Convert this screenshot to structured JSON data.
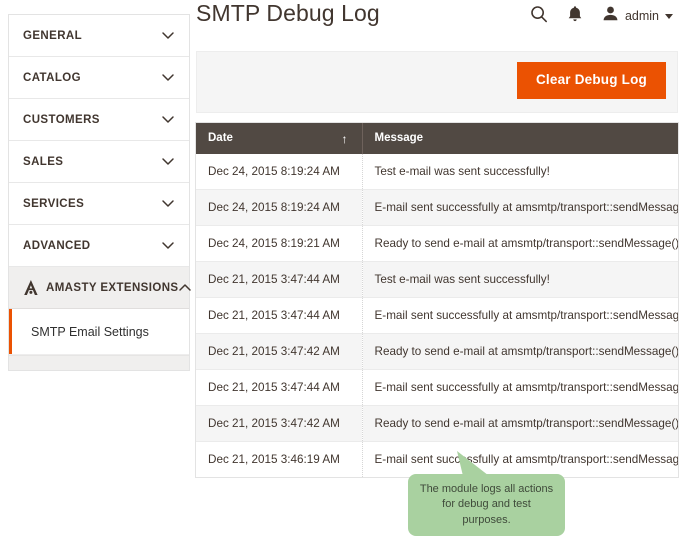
{
  "header": {
    "title": "SMTP Debug Log",
    "search_icon": "search-icon",
    "bell_icon": "notifications-bell-icon",
    "user_icon": "user-avatar-icon",
    "user_name": "admin"
  },
  "sidebar": {
    "items": [
      {
        "label": "GENERAL",
        "icon": "chevron-down-icon",
        "expanded": false
      },
      {
        "label": "CATALOG",
        "icon": "chevron-down-icon",
        "expanded": false
      },
      {
        "label": "CUSTOMERS",
        "icon": "chevron-down-icon",
        "expanded": false
      },
      {
        "label": "SALES",
        "icon": "chevron-down-icon",
        "expanded": false
      },
      {
        "label": "SERVICES",
        "icon": "chevron-down-icon",
        "expanded": false
      },
      {
        "label": "ADVANCED",
        "icon": "chevron-down-icon",
        "expanded": false
      },
      {
        "label": "AMASTY EXTENSIONS",
        "icon": "chevron-up-icon",
        "expanded": true
      }
    ],
    "sub_items": [
      {
        "label": "SMTP Email Settings",
        "selected": true
      }
    ]
  },
  "toolbar": {
    "clear_button_label": "Clear Debug Log"
  },
  "table": {
    "columns": [
      {
        "key": "date",
        "label": "Date",
        "sort": "ascending",
        "sort_glyph": "↑"
      },
      {
        "key": "message",
        "label": "Message",
        "sort": "none",
        "sort_glyph": ""
      }
    ],
    "rows": [
      {
        "date": "Dec 24, 2015 8:19:24 AM",
        "message": "Test e-mail was sent successfully!"
      },
      {
        "date": "Dec 24, 2015 8:19:24 AM",
        "message": "E-mail sent successfully at amsmtp/transport::sendMessage()."
      },
      {
        "date": "Dec 24, 2015 8:19:21 AM",
        "message": "Ready to send e-mail at amsmtp/transport::sendMessage()"
      },
      {
        "date": "Dec 21, 2015 3:47:44 AM",
        "message": "Test e-mail was sent successfully!"
      },
      {
        "date": "Dec 21, 2015 3:47:44 AM",
        "message": "E-mail sent successfully at amsmtp/transport::sendMessage()."
      },
      {
        "date": "Dec 21, 2015 3:47:42 AM",
        "message": "Ready to send e-mail at amsmtp/transport::sendMessage()"
      },
      {
        "date": "Dec 21, 2015 3:47:44 AM",
        "message": "E-mail sent successfully at amsmtp/transport::sendMessage()."
      },
      {
        "date": "Dec 21, 2015 3:47:42 AM",
        "message": "Ready to send e-mail at amsmtp/transport::sendMessage()"
      },
      {
        "date": "Dec 21, 2015 3:46:19 AM",
        "message": "E-mail sent successfully at amsmtp/transport::sendMessage()."
      }
    ]
  },
  "callout": {
    "text": "The module logs all actions for debug and test purposes."
  },
  "colors": {
    "accent_orange": "#eb5202",
    "table_header_brown": "#514943",
    "callout_green": "#a9d1a0",
    "panel_gray": "#f5f5f5",
    "text_dark": "#41362f"
  }
}
